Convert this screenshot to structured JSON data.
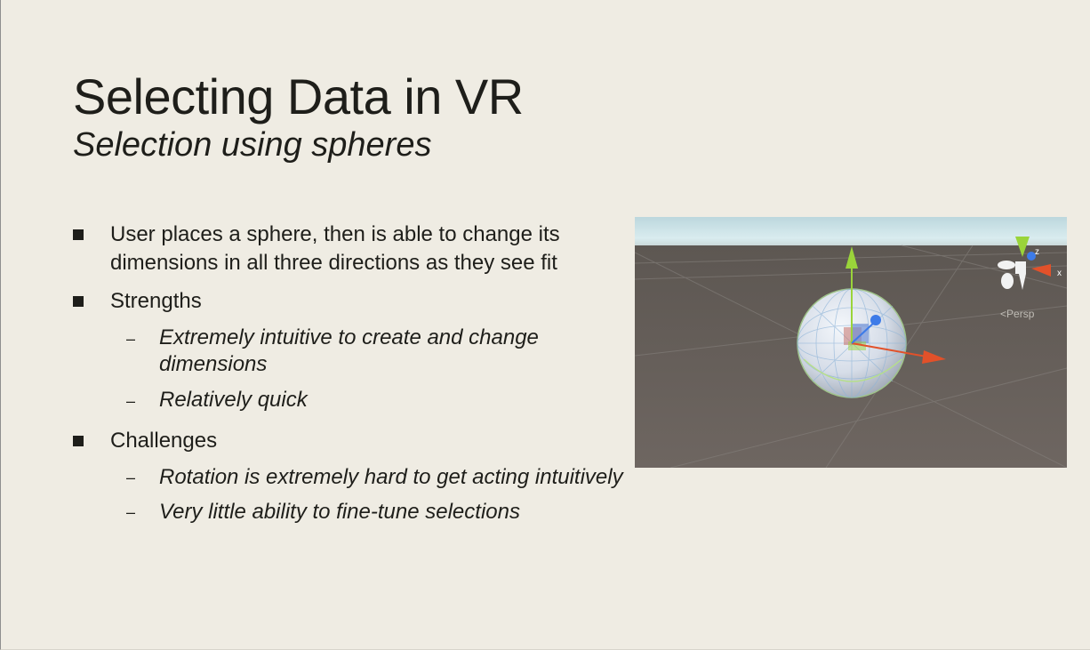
{
  "slide": {
    "title": "Selecting Data in VR",
    "subtitle": "Selection using spheres",
    "bullets": [
      {
        "text_line1": "User places a sphere, then is able to change its",
        "text_line2": "dimensions in all three directions as they see fit"
      },
      {
        "text": "Strengths",
        "subitems": [
          {
            "line1": "Extremely intuitive to create and change",
            "line2": "dimensions"
          },
          {
            "line1": "Relatively quick"
          }
        ]
      },
      {
        "text": "Challenges",
        "subitems": [
          {
            "line1": "Rotation is extremely hard to get acting intuitively"
          },
          {
            "line1": "Very little ability to fine-tune selections"
          }
        ]
      }
    ],
    "sub_bullet_symbol": "–"
  },
  "scene_view": {
    "projection_label": "Persp",
    "gizmo_axes": {
      "z": "z",
      "x": "x"
    },
    "colors": {
      "ground": "#6b635f",
      "sky": "#cfe4e9",
      "x_axis": "#e2512a",
      "y_axis": "#9ad43a",
      "z_axis": "#3d7be8"
    },
    "icons": [
      "orientation-gizmo-icon",
      "back-arrow-icon"
    ]
  }
}
